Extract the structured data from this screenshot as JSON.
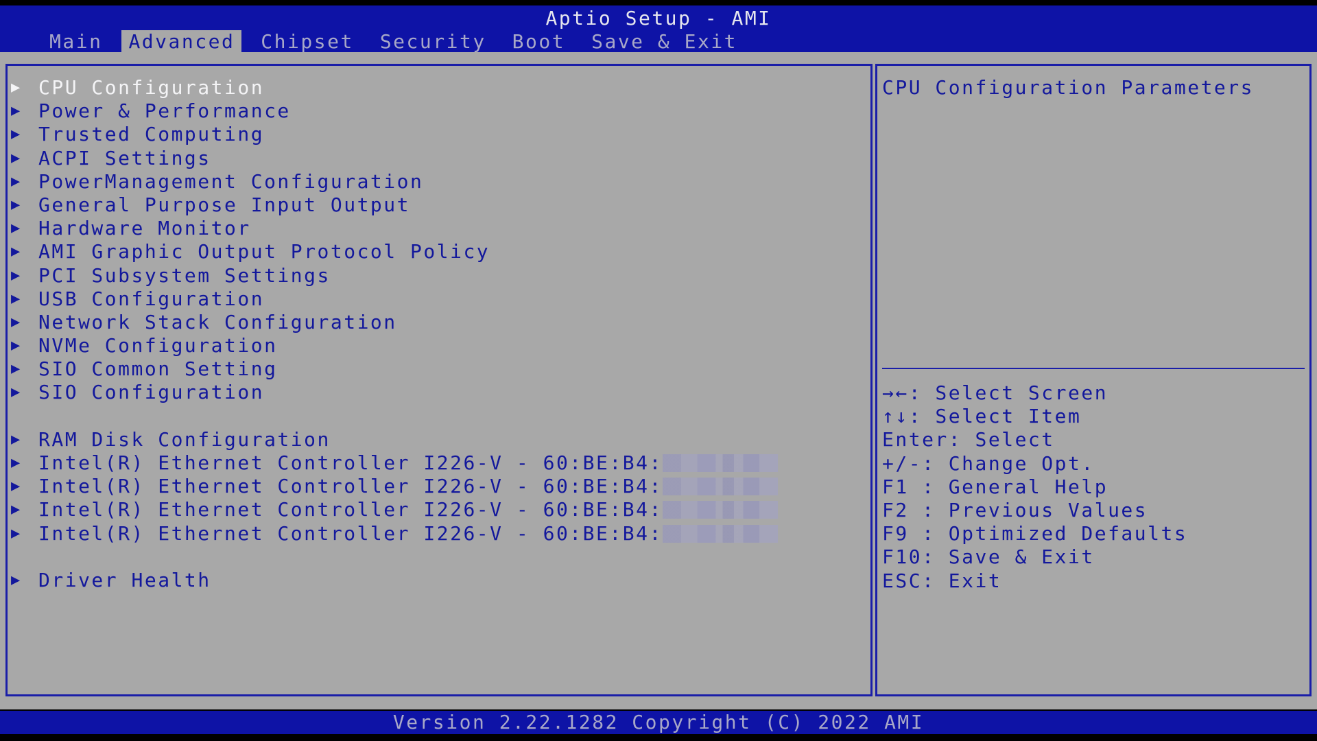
{
  "window_title": "Aptio Setup - AMI",
  "tabs": [
    {
      "label": "Main"
    },
    {
      "label": "Advanced"
    },
    {
      "label": "Chipset"
    },
    {
      "label": "Security"
    },
    {
      "label": "Boot"
    },
    {
      "label": "Save & Exit"
    }
  ],
  "active_tab": "Advanced",
  "menu": {
    "items": [
      {
        "label": "CPU Configuration"
      },
      {
        "label": "Power & Performance"
      },
      {
        "label": "Trusted Computing"
      },
      {
        "label": "ACPI Settings"
      },
      {
        "label": "PowerManagement Configuration"
      },
      {
        "label": "General Purpose Input Output"
      },
      {
        "label": "Hardware Monitor"
      },
      {
        "label": "AMI Graphic Output Protocol Policy"
      },
      {
        "label": "PCI Subsystem Settings"
      },
      {
        "label": "USB Configuration"
      },
      {
        "label": "Network Stack Configuration"
      },
      {
        "label": "NVMe Configuration"
      },
      {
        "label": "SIO Common Setting"
      },
      {
        "label": "SIO Configuration"
      },
      {
        "label": "RAM Disk Configuration"
      },
      {
        "label": "Intel(R) Ethernet Controller I226-V - 60:BE:B4:"
      },
      {
        "label": "Intel(R) Ethernet Controller I226-V - 60:BE:B4:"
      },
      {
        "label": "Intel(R) Ethernet Controller I226-V - 60:BE:B4:"
      },
      {
        "label": "Intel(R) Ethernet Controller I226-V - 60:BE:B4:"
      },
      {
        "label": "Driver Health"
      }
    ],
    "arrow_glyph": "▶"
  },
  "help": {
    "description": "CPU Configuration Parameters",
    "keys": [
      "→←: Select Screen",
      "↑↓: Select Item",
      "Enter: Select",
      "+/-: Change Opt.",
      "F1 : General Help",
      "F2 : Previous Values",
      "F9 : Optimized Defaults",
      "F10: Save & Exit",
      "ESC: Exit"
    ]
  },
  "footer": {
    "version": "Version 2.22.1282 Copyright (C) 2022 AMI"
  },
  "colors": {
    "header_blue": "#0e13a6",
    "panel_gray": "#a8a8a8",
    "text_blue": "#13189c",
    "selected_text": "#f4f4f6"
  }
}
